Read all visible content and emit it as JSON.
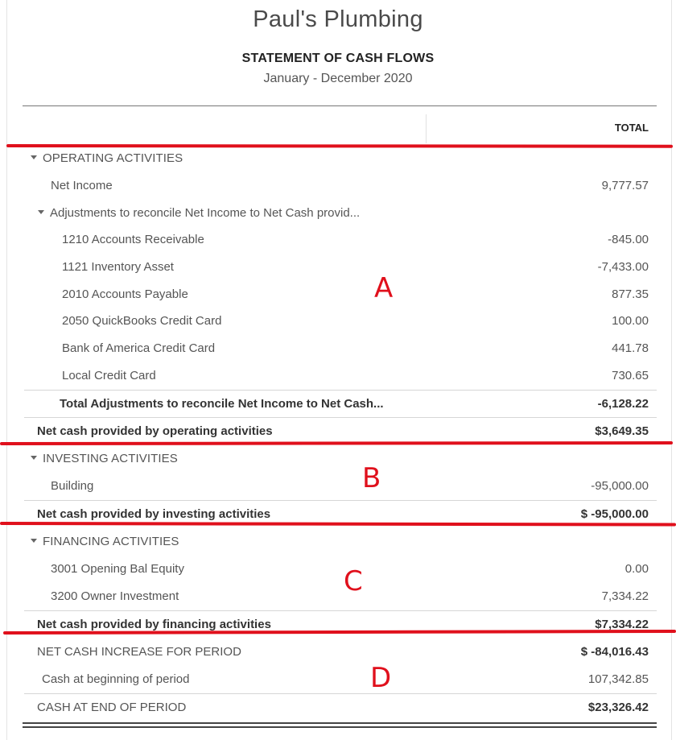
{
  "header": {
    "company": "Paul's Plumbing",
    "title": "STATEMENT OF CASH FLOWS",
    "period": "January - December 2020",
    "column_header": "TOTAL"
  },
  "rows": {
    "operating_header": "OPERATING ACTIVITIES",
    "net_income": {
      "label": "Net Income",
      "value": "9,777.57"
    },
    "adjustments_header": "Adjustments to reconcile Net Income to Net Cash provid...",
    "adjustments": [
      {
        "label": "1210 Accounts Receivable",
        "value": "-845.00"
      },
      {
        "label": "1121 Inventory Asset",
        "value": "-7,433.00"
      },
      {
        "label": "2010 Accounts Payable",
        "value": "877.35"
      },
      {
        "label": "2050 QuickBooks Credit Card",
        "value": "100.00"
      },
      {
        "label": "Bank of America Credit Card",
        "value": "441.78"
      },
      {
        "label": "Local Credit Card",
        "value": "730.65"
      }
    ],
    "total_adjustments": {
      "label": "Total Adjustments to reconcile Net Income to Net Cash...",
      "value": "-6,128.22"
    },
    "net_operating": {
      "label": "Net cash provided by operating activities",
      "value": "$3,649.35"
    },
    "investing_header": "INVESTING ACTIVITIES",
    "building": {
      "label": "Building",
      "value": "-95,000.00"
    },
    "net_investing": {
      "label": "Net cash provided by investing activities",
      "value": "$ -95,000.00"
    },
    "financing_header": "FINANCING ACTIVITIES",
    "financing": [
      {
        "label": "3001 Opening Bal Equity",
        "value": "0.00"
      },
      {
        "label": "3200 Owner Investment",
        "value": "7,334.22"
      }
    ],
    "net_financing": {
      "label": "Net cash provided by financing activities",
      "value": "$7,334.22"
    },
    "net_increase": {
      "label": "NET CASH INCREASE FOR PERIOD",
      "value": "$ -84,016.43"
    },
    "cash_beginning": {
      "label": "Cash at beginning of period",
      "value": "107,342.85"
    },
    "cash_end": {
      "label": "CASH AT END OF PERIOD",
      "value": "$23,326.42"
    }
  },
  "annotations": {
    "a": "A",
    "b": "B",
    "c": "C",
    "d": "D",
    "color": "#e0101c"
  }
}
